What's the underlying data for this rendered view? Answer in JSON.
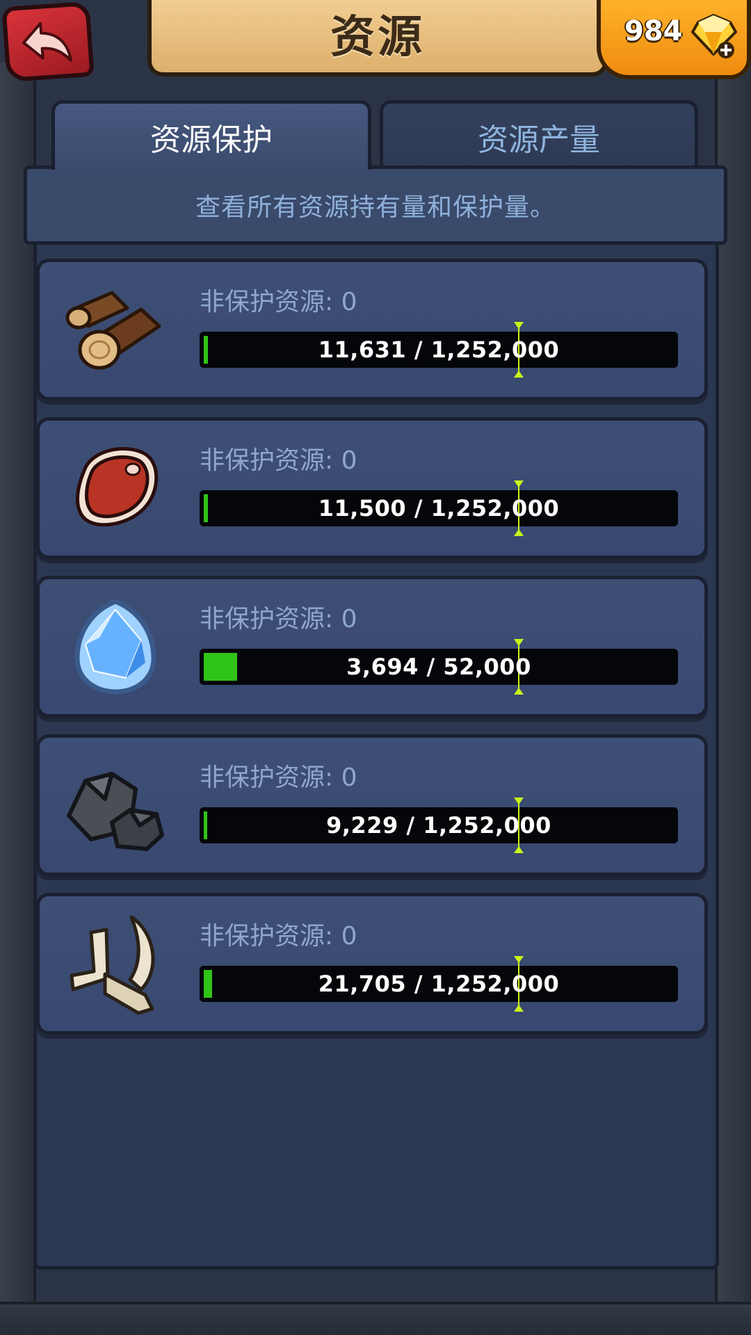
{
  "header": {
    "title": "资源",
    "gems": "984"
  },
  "tabs": [
    {
      "label": "资源保护",
      "active": true
    },
    {
      "label": "资源产量",
      "active": false
    }
  ],
  "description": "查看所有资源持有量和保护量。",
  "resources": [
    {
      "icon": "wood-log-icon",
      "label": "非保护资源: 0",
      "amount": "11,631 / 1,252,000",
      "fill_fraction": 0.0093
    },
    {
      "icon": "meat-steak-icon",
      "label": "非保护资源: 0",
      "amount": "11,500 / 1,252,000",
      "fill_fraction": 0.0092
    },
    {
      "icon": "crystal-icon",
      "label": "非保护资源: 0",
      "amount": "3,694 / 52,000",
      "fill_fraction": 0.071
    },
    {
      "icon": "stone-icon",
      "label": "非保护资源: 0",
      "amount": "9,229 / 1,252,000",
      "fill_fraction": 0.0074
    },
    {
      "icon": "bone-icon",
      "label": "非保护资源: 0",
      "amount": "21,705 / 1,252,000",
      "fill_fraction": 0.0173
    }
  ],
  "colors": {
    "fill": "#2fc417",
    "marker": "#c9f51a",
    "tab_inactive_text": "#8fb4de"
  }
}
